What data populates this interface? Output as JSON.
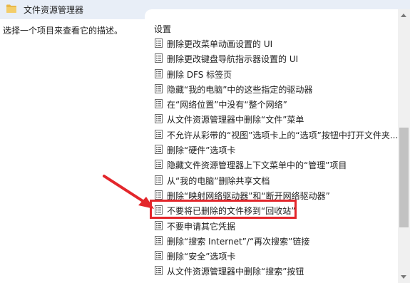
{
  "header": {
    "title": "文件资源管理器",
    "icon": "folder-icon"
  },
  "left_pane": {
    "description": "选择一个项目来查看它的描述。"
  },
  "right_pane": {
    "section_heading": "设置",
    "items": [
      {
        "label": "删除更改菜单动画设置的 UI",
        "icon": "policy-setting-icon"
      },
      {
        "label": "删除更改键盘导航指示器设置的 UI",
        "icon": "policy-setting-icon"
      },
      {
        "label": "删除 DFS 标签页",
        "icon": "policy-setting-icon"
      },
      {
        "label": "隐藏“我的电脑”中的这些指定的驱动器",
        "icon": "policy-setting-icon"
      },
      {
        "label": "在“网络位置”中没有“整个网络”",
        "icon": "policy-setting-icon"
      },
      {
        "label": "从文件资源管理器中删除“文件”菜单",
        "icon": "policy-setting-icon"
      },
      {
        "label": "不允许从彩带的“视图”选项卡上的“选项”按钮中打开文件夹...",
        "icon": "policy-setting-icon"
      },
      {
        "label": "删除“硬件”选项卡",
        "icon": "policy-setting-icon"
      },
      {
        "label": "隐藏文件资源管理器上下文菜单中的“管理”项目",
        "icon": "policy-setting-icon"
      },
      {
        "label": "从“我的电脑”删除共享文档",
        "icon": "policy-setting-icon"
      },
      {
        "label": "删除“映射网络驱动器”和“断开网络驱动器”",
        "icon": "policy-setting-icon"
      },
      {
        "label": "不要将已删除的文件移到“回收站”",
        "icon": "policy-setting-icon"
      },
      {
        "label": "不要申请其它凭据",
        "icon": "policy-setting-icon"
      },
      {
        "label": "删除“搜索 Internet”/“再次搜索”链接",
        "icon": "policy-setting-icon"
      },
      {
        "label": "删除“安全”选项卡",
        "icon": "policy-setting-icon"
      },
      {
        "label": "从文件资源管理器中删除“搜索”按钮",
        "icon": "policy-setting-icon"
      }
    ]
  },
  "annotation": {
    "highlight_color": "#e3262b",
    "highlighted_item": "不要将已删除的文件移到“回收站”"
  },
  "colors": {
    "header_bg": "#e8eef7",
    "folder_yellow": "#e8b84a",
    "text": "#1e1e1e"
  }
}
